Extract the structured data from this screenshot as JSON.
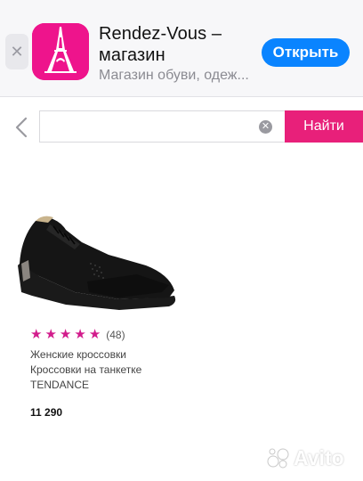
{
  "app_banner": {
    "close_glyph": "✕",
    "title": "Rendez-Vous – магазин",
    "subtitle": "Магазин обуви, одеж...",
    "open_label": "Открыть",
    "icon_color": "#ee148c",
    "button_color": "#0a84ff"
  },
  "search": {
    "back_icon": "chevron-left-icon",
    "value": "",
    "clear_glyph": "✕",
    "button_label": "Найти",
    "button_color": "#e8207a"
  },
  "product": {
    "rating_stars": 5,
    "rating_max": 5,
    "reviews": "(48)",
    "category": "Женские кроссовки",
    "name": "Кроссовки на танкетке",
    "brand": "TENDANCE",
    "price": "11 290",
    "star_color": "#d21c8c"
  },
  "watermark": {
    "text": "Avito"
  }
}
